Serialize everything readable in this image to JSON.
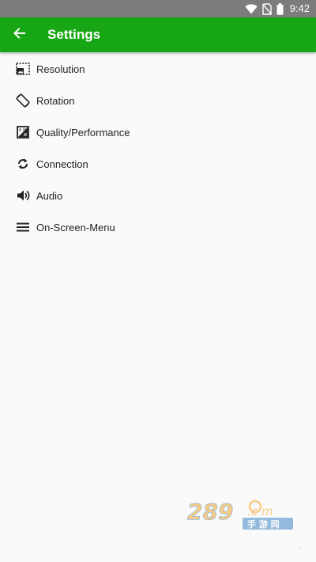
{
  "status_bar": {
    "time": "9:42",
    "icons": [
      "wifi-icon",
      "no-sim-icon",
      "battery-icon"
    ]
  },
  "app_bar": {
    "title": "Settings",
    "back_icon": "arrow-left-icon",
    "color": "#17a714"
  },
  "menu": {
    "items": [
      {
        "label": "Resolution",
        "icon": "resolution-icon"
      },
      {
        "label": "Rotation",
        "icon": "screen-rotation-icon"
      },
      {
        "label": "Quality/Performance",
        "icon": "quality-icon"
      },
      {
        "label": "Connection",
        "icon": "sync-icon"
      },
      {
        "label": "Audio",
        "icon": "volume-icon"
      },
      {
        "label": "On-Screen-Menu",
        "icon": "menu-lines-icon"
      }
    ]
  },
  "watermark": {
    "brand": "289.com",
    "subtitle": "手游网"
  }
}
